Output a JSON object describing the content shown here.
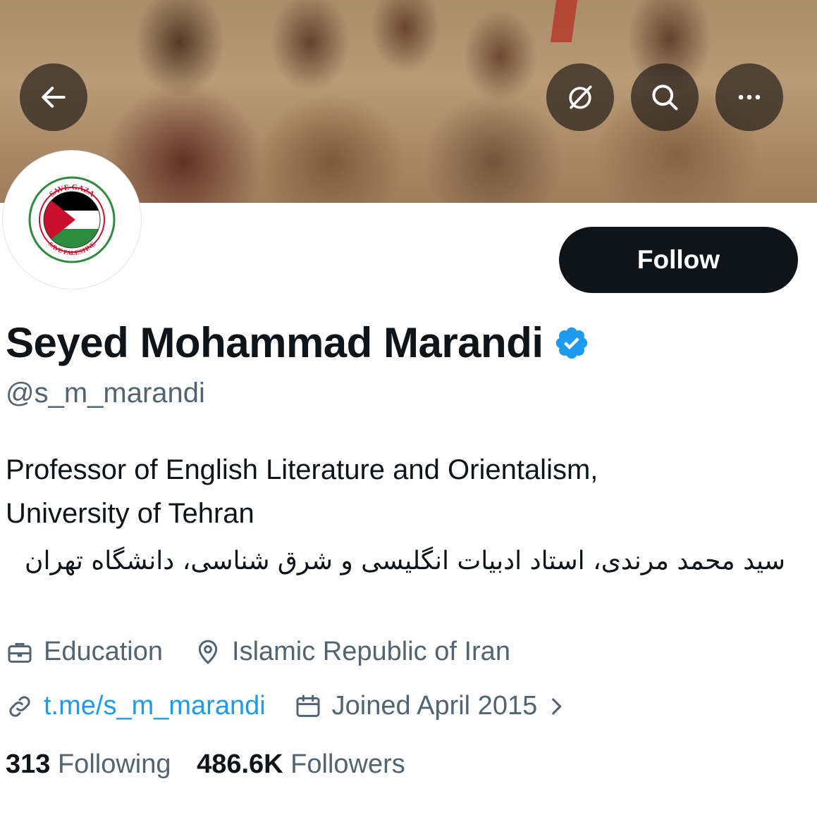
{
  "header": {
    "back_icon": "arrow-left-icon",
    "notify_icon": "bell-off-icon",
    "search_icon": "search-icon",
    "more_icon": "more-horizontal-icon"
  },
  "profile": {
    "avatar_top_text": "SAVE GAZA",
    "avatar_bottom_text": "SAVE PALESTINE",
    "follow_label": "Follow",
    "name": "Seyed Mohammad Marandi",
    "handle": "@s_m_marandi",
    "bio_en_line1": "Professor of English Literature and Orientalism,",
    "bio_en_line2": "University of Tehran",
    "bio_fa": "سید محمد مرندی، استاد ادبیات انگلیسی و شرق شناسی، دانشگاه تهران",
    "category": "Education",
    "location": "Islamic Republic of Iran",
    "website": "t.me/s_m_marandi",
    "joined": "Joined April 2015",
    "following_count": "313",
    "following_label": "Following",
    "followers_count": "486.6K",
    "followers_label": "Followers"
  },
  "colors": {
    "accent": "#1d9bf0",
    "text_primary": "#0f1419",
    "text_secondary": "#536471",
    "button_bg": "#0f1419"
  }
}
